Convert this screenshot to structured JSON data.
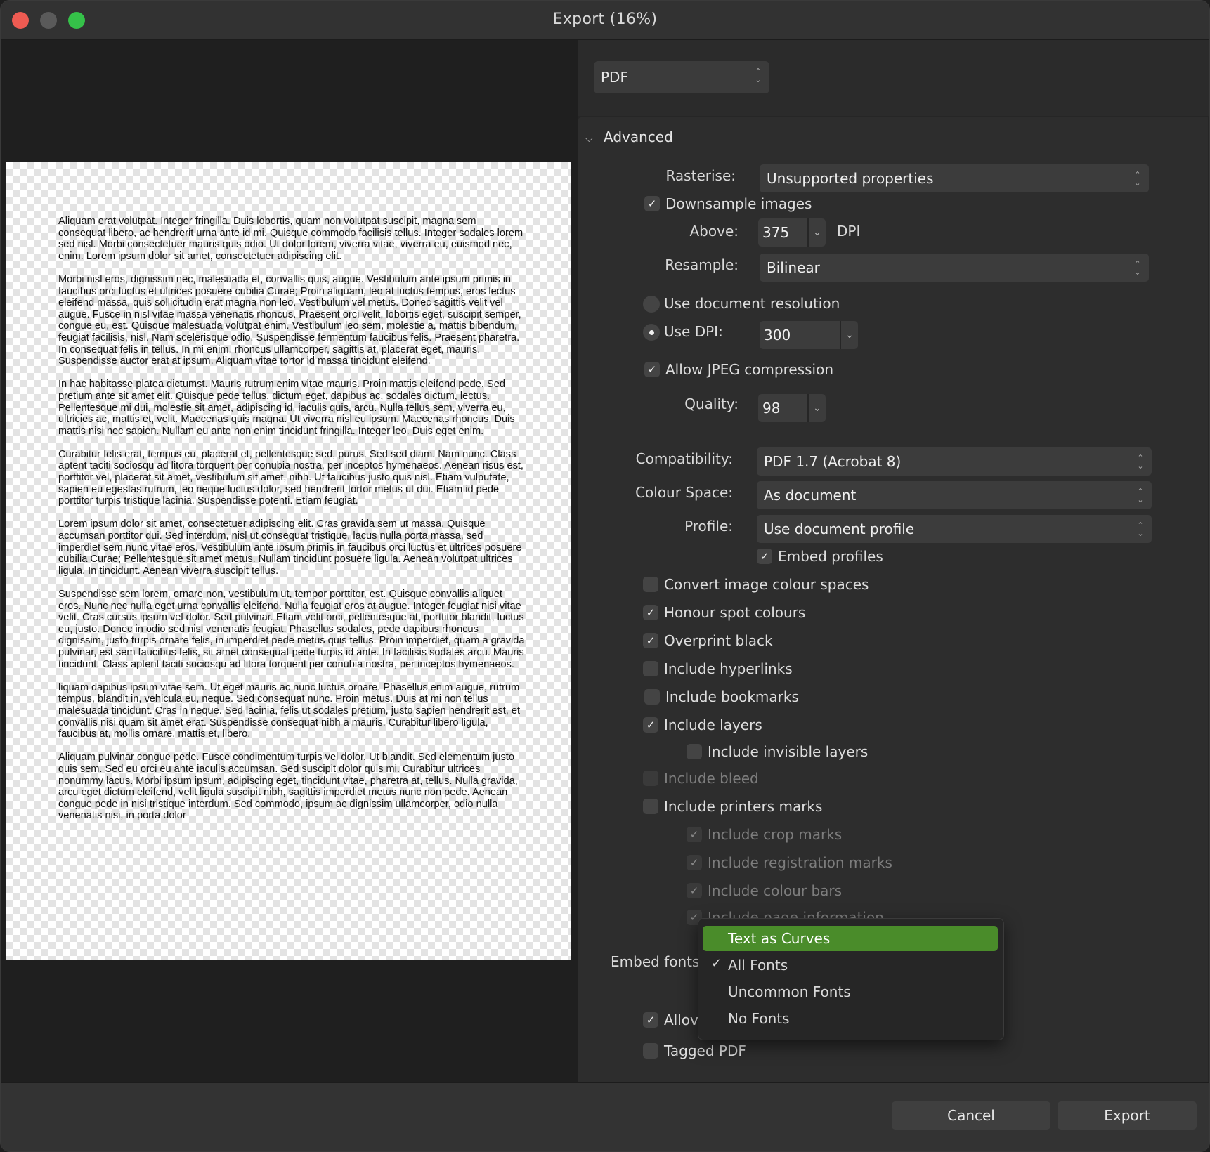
{
  "window": {
    "title": "Export (16%)"
  },
  "format": {
    "value": "PDF"
  },
  "advanced": {
    "header": "Advanced",
    "rasterise": {
      "label": "Rasterise:",
      "value": "Unsupported properties"
    },
    "downsample": {
      "label": "Downsample images",
      "checked": true
    },
    "above": {
      "label": "Above:",
      "value": "375",
      "unit": "DPI"
    },
    "resample": {
      "label": "Resample:",
      "value": "Bilinear"
    },
    "use_doc_res": {
      "label": "Use document resolution",
      "selected": false
    },
    "use_dpi": {
      "label": "Use DPI:",
      "value": "300",
      "selected": true
    },
    "jpeg": {
      "label": "Allow JPEG compression",
      "checked": true
    },
    "quality": {
      "label": "Quality:",
      "value": "98"
    },
    "compatibility": {
      "label": "Compatibility:",
      "value": "PDF 1.7 (Acrobat 8)"
    },
    "colour_space": {
      "label": "Colour Space:",
      "value": "As document"
    },
    "profile": {
      "label": "Profile:",
      "value": "Use document profile"
    },
    "embed_profiles": {
      "label": "Embed profiles",
      "checked": true
    },
    "convert_colour": {
      "label": "Convert image colour spaces",
      "checked": false
    },
    "spot_colours": {
      "label": "Honour spot colours",
      "checked": true
    },
    "overprint": {
      "label": "Overprint black",
      "checked": true
    },
    "hyperlinks": {
      "label": "Include hyperlinks",
      "checked": false
    },
    "bookmarks": {
      "label": "Include bookmarks",
      "checked": false
    },
    "layers": {
      "label": "Include layers",
      "checked": true
    },
    "invisible_layers": {
      "label": "Include invisible layers",
      "checked": false
    },
    "bleed": {
      "label": "Include bleed",
      "checked": false
    },
    "printers_marks": {
      "label": "Include printers marks",
      "checked": false
    },
    "crop_marks": {
      "label": "Include crop marks",
      "checked": true
    },
    "reg_marks": {
      "label": "Include registration marks",
      "checked": true
    },
    "colour_bars": {
      "label": "Include colour bars",
      "checked": true
    },
    "page_info": {
      "label": "Include page information",
      "checked": true
    },
    "embed_fonts": {
      "label": "Embed fonts"
    },
    "allow_partial": {
      "label": "Allov",
      "checked": true
    },
    "tagged_pdf": {
      "label": "Tagged PDF",
      "checked": false
    }
  },
  "font_menu": {
    "items": [
      {
        "label": "Text as Curves",
        "highlighted": true,
        "checked": false
      },
      {
        "label": "All Fonts",
        "highlighted": false,
        "checked": true
      },
      {
        "label": "Uncommon Fonts",
        "highlighted": false,
        "checked": false
      },
      {
        "label": "No Fonts",
        "highlighted": false,
        "checked": false
      }
    ],
    "highlight_color": "#4a8c2a"
  },
  "buttons": {
    "cancel": "Cancel",
    "export": "Export"
  },
  "preview": {
    "paragraphs": [
      "Aliquam erat volutpat. Integer fringilla. Duis lobortis, quam non volutpat suscipit, magna sem consequat libero, ac hendrerit urna ante id mi. Quisque commodo facilisis tellus. Integer sodales lorem sed nisl. Morbi consectetuer mauris quis odio. Ut dolor lorem, viverra vitae, viverra eu, euismod nec, enim. Lorem ipsum dolor sit amet, consectetuer adipiscing elit.",
      "Morbi nisl eros, dignissim nec, malesuada et, convallis quis, augue. Vestibulum ante ipsum primis in faucibus orci luctus et ultrices posuere cubilia Curae; Proin aliquam, leo at luctus tempus, eros lectus eleifend massa, quis sollicitudin erat magna non leo. Vestibulum vel metus. Donec sagittis velit vel augue. Fusce in nisl vitae massa venenatis rhoncus. Praesent orci velit, lobortis eget, suscipit semper, congue eu, est. Quisque malesuada volutpat enim. Vestibulum leo sem, molestie a, mattis bibendum, feugiat facilisis, nisl. Nam scelerisque odio. Suspendisse fermentum faucibus felis. Praesent pharetra. In consequat felis in tellus. In mi enim, rhoncus ullamcorper, sagittis at, placerat eget, mauris. Suspendisse auctor erat at ipsum. Aliquam vitae tortor id massa tincidunt eleifend.",
      "In hac habitasse platea dictumst. Mauris rutrum enim vitae mauris. Proin mattis eleifend pede. Sed pretium ante sit amet elit. Quisque pede tellus, dictum eget, dapibus ac, sodales dictum, lectus. Pellentesque mi dui, molestie sit amet, adipiscing id, iaculis quis, arcu. Nulla tellus sem, viverra eu, ultricies ac, mattis et, velit. Maecenas quis magna. Ut viverra nisl eu ipsum. Maecenas rhoncus. Duis mattis nisi nec sapien. Nullam eu ante non enim tincidunt fringilla. Integer leo. Duis eget enim.",
      "Curabitur felis erat, tempus eu, placerat et, pellentesque sed, purus. Sed sed diam. Nam nunc. Class aptent taciti sociosqu ad litora torquent per conubia nostra, per inceptos hymenaeos. Aenean risus est, porttitor vel, placerat sit amet, vestibulum sit amet, nibh. Ut faucibus justo quis nisl. Etiam vulputate, sapien eu egestas rutrum, leo neque luctus dolor, sed hendrerit tortor metus ut dui. Etiam id pede porttitor turpis tristique lacinia. Suspendisse potenti. Etiam feugiat.",
      "Lorem ipsum dolor sit amet, consectetuer adipiscing elit. Cras gravida sem ut massa. Quisque accumsan porttitor dui. Sed interdum, nisl ut consequat tristique, lacus nulla porta massa, sed imperdiet sem nunc vitae eros. Vestibulum ante ipsum primis in faucibus orci luctus et ultrices posuere cubilia Curae; Pellentesque sit amet metus. Nullam tincidunt posuere ligula. Aenean volutpat ultrices ligula. In tincidunt. Aenean viverra suscipit tellus.",
      "Suspendisse sem lorem, ornare non, vestibulum ut, tempor porttitor, est. Quisque convallis aliquet eros. Nunc nec nulla eget urna convallis eleifend. Nulla feugiat eros at augue. Integer feugiat nisi vitae velit. Cras cursus ipsum vel dolor. Sed pulvinar. Etiam velit orci, pellentesque at, porttitor blandit, luctus eu, justo. Donec in odio sed nisl venenatis feugiat. Phasellus sodales, pede dapibus rhoncus dignissim, justo turpis ornare felis, in imperdiet pede metus quis tellus. Proin imperdiet, quam a gravida pulvinar, est sem faucibus felis, sit amet consequat pede turpis id ante. In facilisis sodales arcu. Mauris tincidunt. Class aptent taciti sociosqu ad litora torquent per conubia nostra, per inceptos hymenaeos.",
      "liquam dapibus ipsum vitae sem. Ut eget mauris ac nunc luctus ornare. Phasellus enim augue, rutrum tempus, blandit in, vehicula eu, neque. Sed consequat nunc. Proin metus. Duis at mi non tellus malesuada tincidunt. Cras in neque. Sed lacinia, felis ut sodales pretium, justo sapien hendrerit est, et convallis nisi quam sit amet erat. Suspendisse consequat nibh a mauris. Curabitur libero ligula, faucibus at, mollis ornare, mattis et, libero.",
      "Aliquam pulvinar congue pede. Fusce condimentum turpis vel dolor. Ut blandit. Sed elementum justo quis sem. Sed eu orci eu ante iaculis accumsan. Sed suscipit dolor quis mi. Curabitur ultrices nonummy lacus. Morbi ipsum ipsum, adipiscing eget, tincidunt vitae, pharetra at, tellus. Nulla gravida, arcu eget dictum eleifend, velit ligula suscipit nibh, sagittis imperdiet metus nunc non pede. Aenean congue pede in nisi tristique interdum. Sed commodo, ipsum ac dignissim ullamcorper, odio nulla venenatis nisi, in porta dolor"
    ]
  }
}
